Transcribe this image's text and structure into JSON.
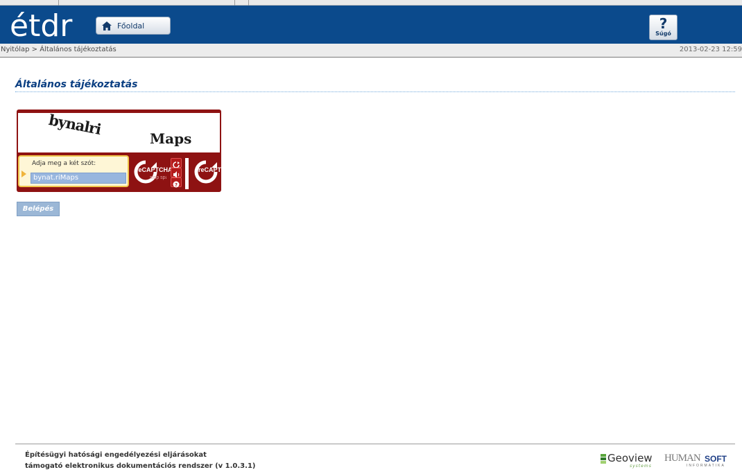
{
  "header": {
    "logo_text": "étdr",
    "home_label": "Főoldal",
    "help_label": "Súgó",
    "home_icon": "home-icon",
    "help_icon": "question-icon",
    "background": "#0b4a8c"
  },
  "breadcrumb": {
    "text": "Nyitólap > Általános tájékoztatás",
    "datetime": "2013-02-23 12:59"
  },
  "main": {
    "title": "Általános tájékoztatás",
    "captcha": {
      "word1": "bynalri",
      "word2": "Maps",
      "prompt": "Adja meg a két szót:",
      "input_value": "bynat.riMaps",
      "brand": "reCAPTCHA",
      "tagline": "stop spam. read books.",
      "icons": [
        "refresh-icon",
        "audio-icon",
        "help-icon"
      ]
    },
    "login_label": "Belépés"
  },
  "footer": {
    "line1": "Építésügyi hatósági engedélyezési eljárásokat",
    "line2": "támogató elektronikus dokumentációs rendszer (v 1.0.3.1)",
    "partner1": "Geoview",
    "partner1_sub": "systems",
    "partner2_a": "HUMAN",
    "partner2_b": "SOFT",
    "partner2_sub": "INFORMATIKA"
  }
}
